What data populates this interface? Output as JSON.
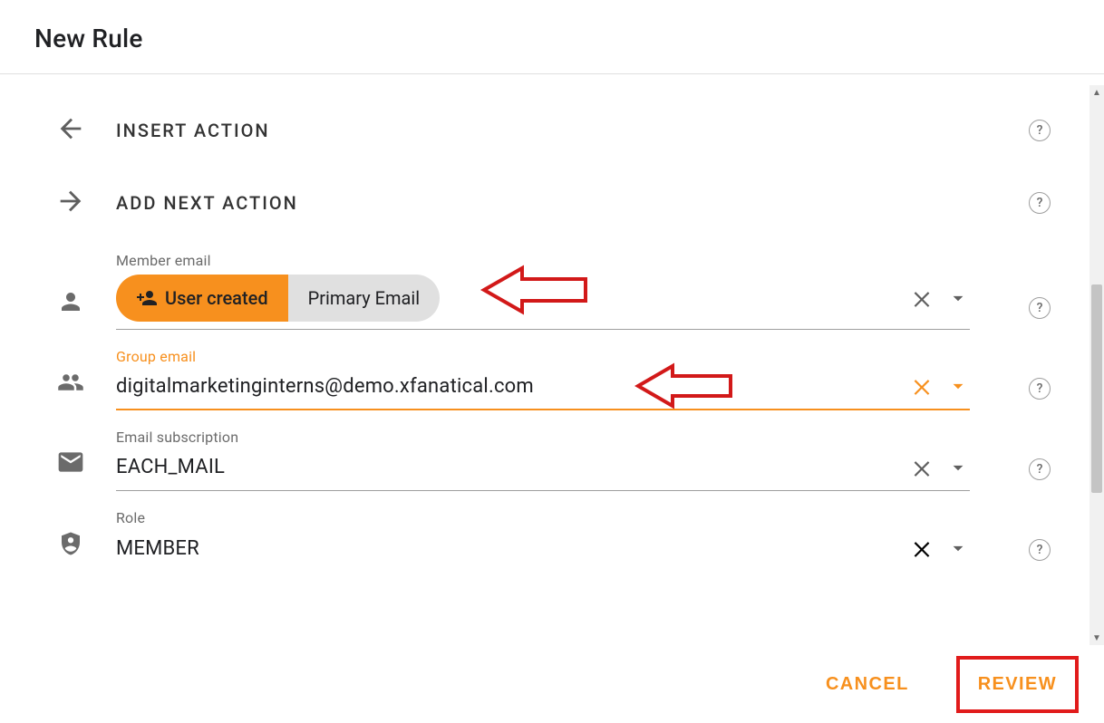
{
  "dialog": {
    "title": "New Rule"
  },
  "sections": {
    "insert_action": "INSERT ACTION",
    "add_next_action": "ADD NEXT ACTION"
  },
  "fields": {
    "member_email": {
      "label": "Member email",
      "chip_user_created": "User created",
      "chip_primary_email": "Primary Email"
    },
    "group_email": {
      "label": "Group email",
      "value": "digitalmarketinginterns@demo.xfanatical.com"
    },
    "email_subscription": {
      "label": "Email subscription",
      "value": "EACH_MAIL"
    },
    "role": {
      "label": "Role",
      "value": "MEMBER"
    }
  },
  "footer": {
    "cancel": "CANCEL",
    "review": "REVIEW"
  },
  "icons": {
    "help": "?"
  }
}
